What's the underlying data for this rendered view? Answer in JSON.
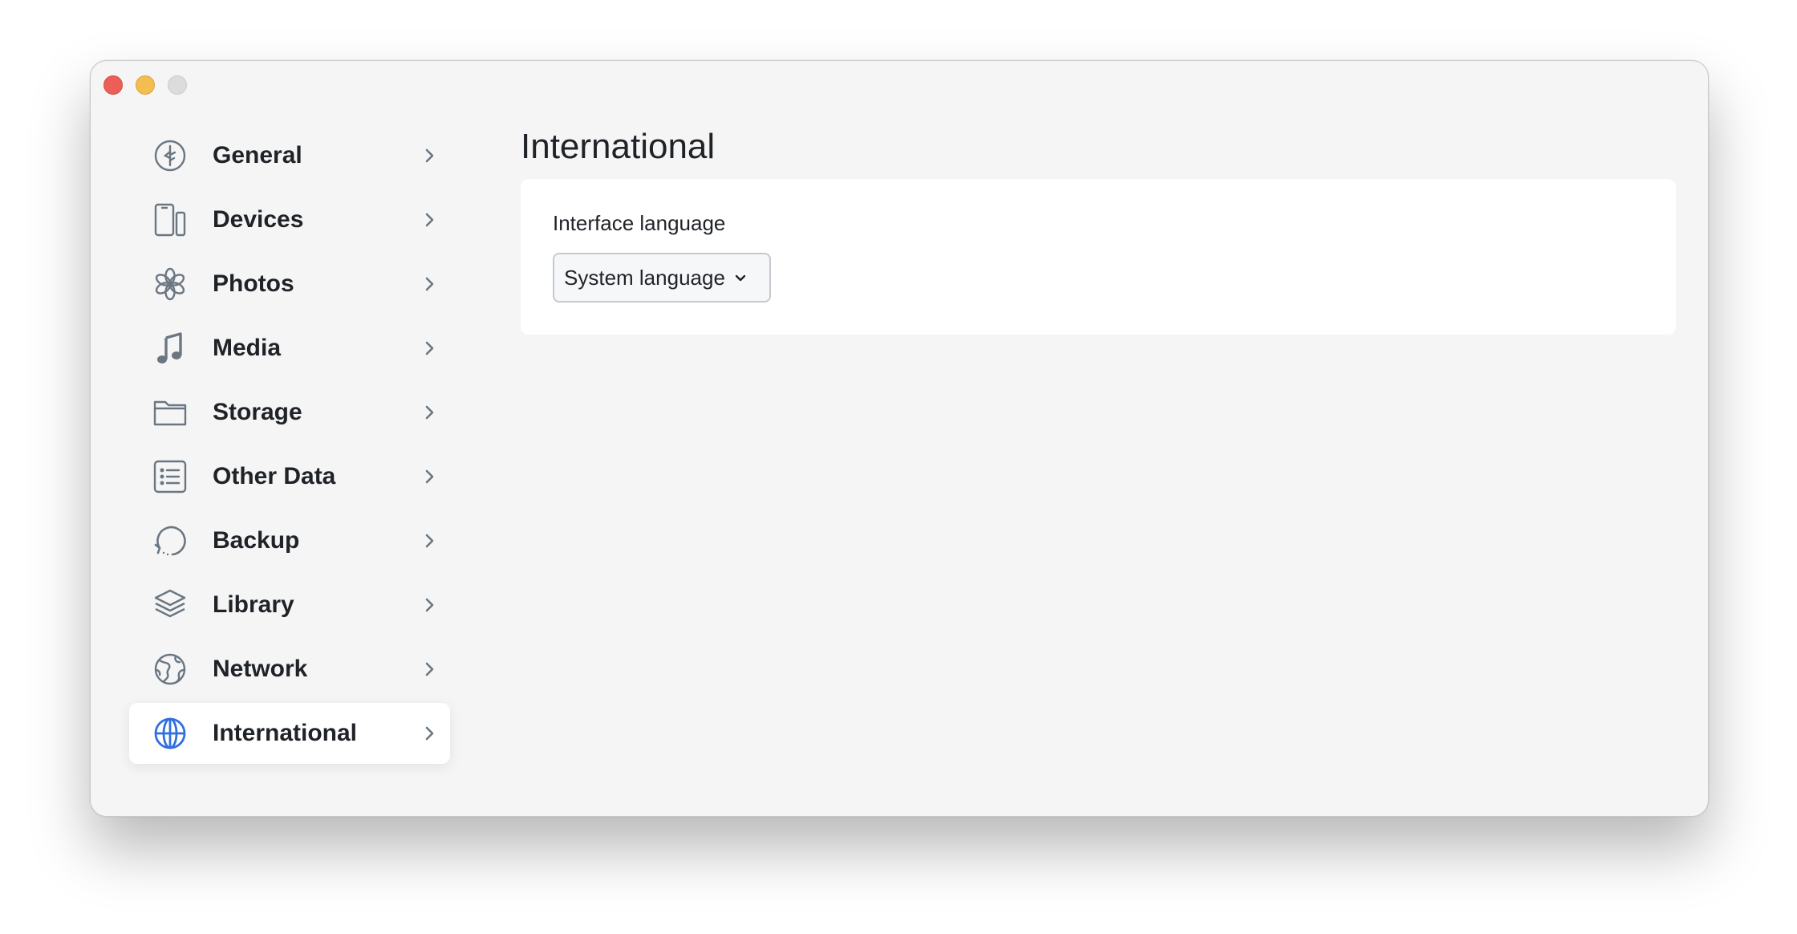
{
  "window": {
    "controls": [
      "close",
      "minimize",
      "maximize"
    ]
  },
  "sidebar": {
    "items": [
      {
        "label": "General",
        "icon": "general-icon",
        "active": false
      },
      {
        "label": "Devices",
        "icon": "devices-icon",
        "active": false
      },
      {
        "label": "Photos",
        "icon": "photos-icon",
        "active": false
      },
      {
        "label": "Media",
        "icon": "music-note-icon",
        "active": false
      },
      {
        "label": "Storage",
        "icon": "folder-icon",
        "active": false
      },
      {
        "label": "Other Data",
        "icon": "list-icon",
        "active": false
      },
      {
        "label": "Backup",
        "icon": "backup-icon",
        "active": false
      },
      {
        "label": "Library",
        "icon": "layers-icon",
        "active": false
      },
      {
        "label": "Network",
        "icon": "network-globe-icon",
        "active": false
      },
      {
        "label": "International",
        "icon": "globe-icon",
        "active": true
      }
    ]
  },
  "main": {
    "title": "International",
    "interface_language": {
      "label": "Interface language",
      "selected": "System language"
    }
  },
  "colors": {
    "window_bg": "#f5f5f5",
    "card_bg": "#ffffff",
    "icon_gray": "#6a7682",
    "icon_active": "#2f6fe0",
    "text": "#1f2328"
  }
}
